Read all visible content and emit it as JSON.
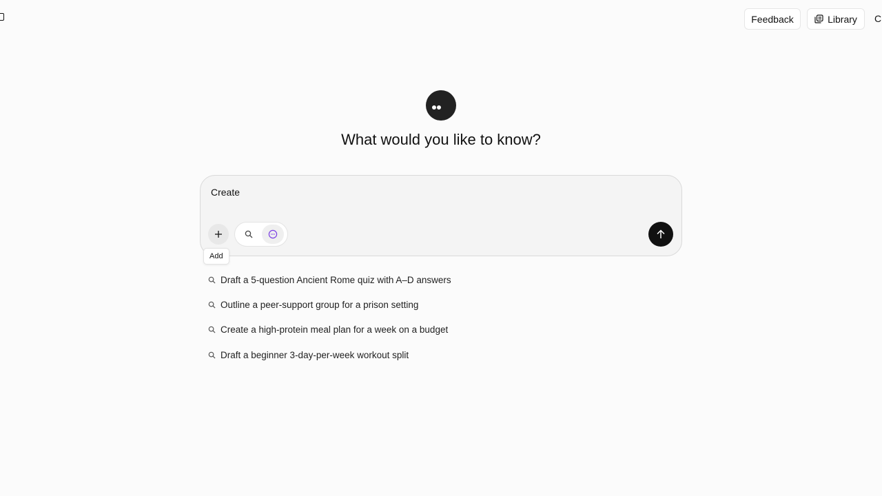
{
  "header": {
    "feedback_label": "Feedback",
    "library_label": "Library",
    "cut_label": "C"
  },
  "headline": "What would you like to know?",
  "composer": {
    "input_value": "Create",
    "add_tooltip": "Add"
  },
  "suggestions": [
    "Draft a 5-question Ancient Rome quiz with A–D answers",
    "Outline a peer-support group for a prison setting",
    "Create a high-protein meal plan for a week on a budget",
    "Draft a beginner 3-day-per-week workout split"
  ],
  "icons": {
    "sidebar": "sidebar-toggle-icon",
    "library": "library-icon",
    "add": "plus-icon",
    "search_mode": "search-icon",
    "chat_mode": "chat-bubble-icon",
    "send": "arrow-up-icon",
    "suggestion": "search-icon"
  },
  "colors": {
    "accent_purple": "#7b3fe4",
    "send_button": "#111111",
    "background": "#fbfbfb"
  }
}
